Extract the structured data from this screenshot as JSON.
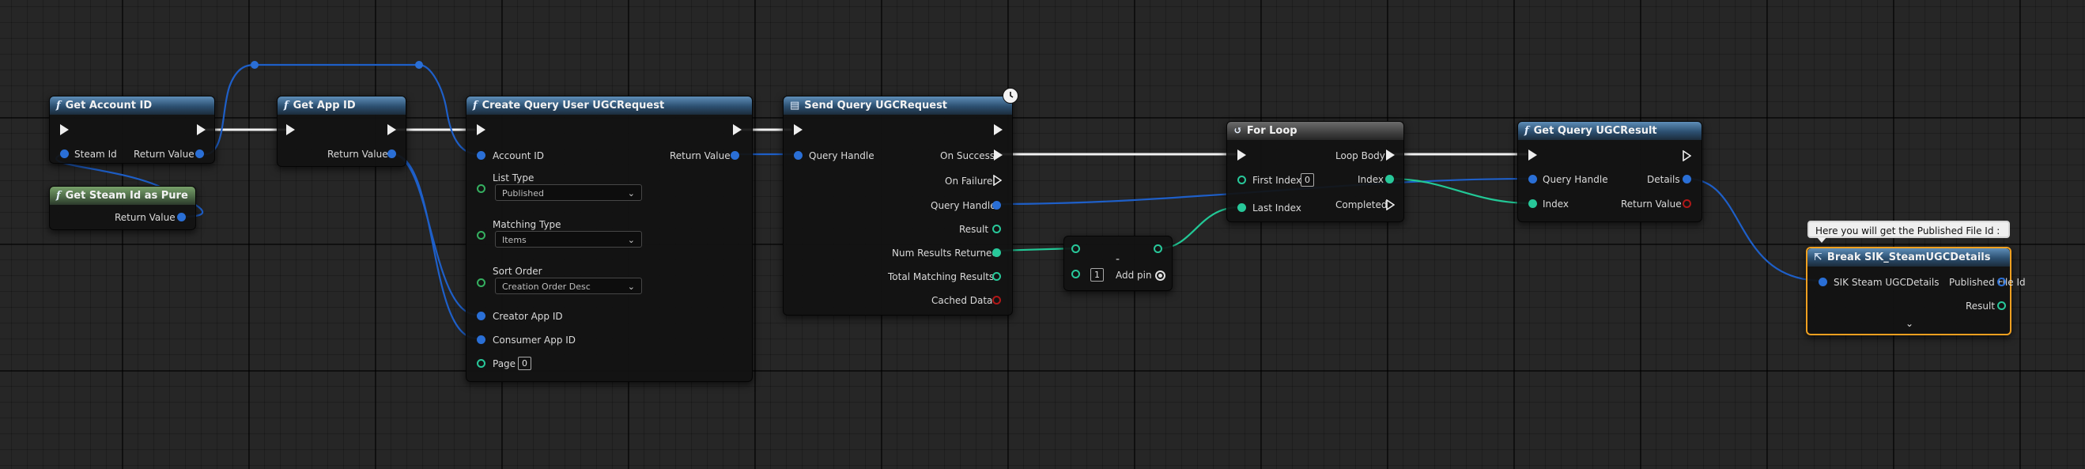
{
  "nodes": {
    "get_account_id": {
      "title": "Get Account ID",
      "pin_steam_id": "Steam Id",
      "pin_return": "Return Value"
    },
    "get_steam_id_pure": {
      "title": "Get Steam Id as Pure",
      "pin_return": "Return Value"
    },
    "get_app_id": {
      "title": "Get App ID",
      "pin_return": "Return Value"
    },
    "create_query": {
      "title": "Create Query User UGCRequest",
      "pin_account_id": "Account ID",
      "pin_return": "Return Value",
      "list_type_label": "List Type",
      "list_type_value": "Published",
      "matching_type_label": "Matching Type",
      "matching_type_value": "Items",
      "sort_order_label": "Sort Order",
      "sort_order_value": "Creation Order Desc",
      "pin_creator_app_id": "Creator App ID",
      "pin_consumer_app_id": "Consumer App ID",
      "pin_page": "Page",
      "page_value": "0"
    },
    "send_query": {
      "title": "Send Query UGCRequest",
      "pin_query_handle_in": "Query Handle",
      "pin_on_success": "On Success",
      "pin_on_failure": "On Failure",
      "pin_query_handle_out": "Query Handle",
      "pin_result": "Result",
      "pin_num_results": "Num Results Returned",
      "pin_total_matching": "Total Matching Results",
      "pin_cached_data": "Cached Data"
    },
    "subtract": {
      "symbol": "-",
      "b_value": "1",
      "add_pin_label": "Add pin"
    },
    "for_loop": {
      "title": "For Loop",
      "pin_first_index": "First Index",
      "first_index_value": "0",
      "pin_last_index": "Last Index",
      "pin_loop_body": "Loop Body",
      "pin_index": "Index",
      "pin_completed": "Completed"
    },
    "get_query_result": {
      "title": "Get Query UGCResult",
      "pin_query_handle": "Query Handle",
      "pin_index": "Index",
      "pin_details": "Details",
      "pin_return": "Return Value"
    },
    "break_details": {
      "title": "Break SIK_SteamUGCDetails",
      "pin_details_in": "SIK Steam UGCDetails",
      "pin_published_file_id": "Published File Id",
      "pin_result": "Result",
      "comment": "Here you will get the Published File Id :"
    }
  },
  "colors": {
    "exec_wire": "#ffffff",
    "object_wire": "#1e5fc8",
    "int_wire": "#22c896",
    "selection": "#f0a020",
    "function_header": "#2c4f70",
    "pure_header": "#4e6c48"
  }
}
